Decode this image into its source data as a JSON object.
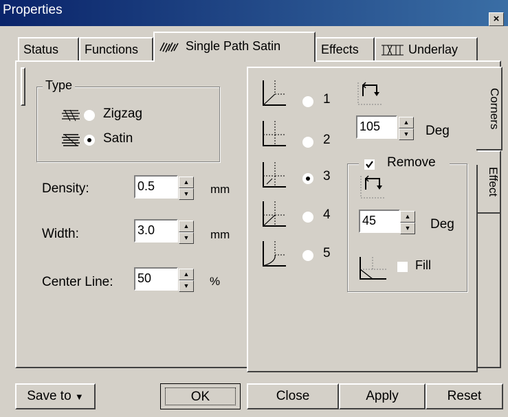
{
  "window": {
    "title": "Properties",
    "close_glyph": "×"
  },
  "tabs": [
    {
      "label": "Status",
      "icon": ""
    },
    {
      "label": "Functions",
      "icon": ""
    },
    {
      "label": "Single Path Satin",
      "icon": "stitch-icon",
      "active": true
    },
    {
      "label": "Effects",
      "icon": ""
    },
    {
      "label": "Underlay",
      "icon": "underlay-icon"
    }
  ],
  "type_group": {
    "legend": "Type",
    "options": [
      {
        "label": "Zigzag",
        "icon": "zigzag-icon",
        "checked": false
      },
      {
        "label": "Satin",
        "icon": "satin-icon",
        "checked": true
      }
    ]
  },
  "settings": [
    {
      "label": "Density:",
      "value": "0.5",
      "unit": "mm"
    },
    {
      "label": "Width:",
      "value": "3.0",
      "unit": "mm"
    },
    {
      "label": "Center Line:",
      "value": "50",
      "unit": "%"
    }
  ],
  "side_tabs": {
    "corners": "Corners",
    "effect": "Effect"
  },
  "corners": {
    "options": [
      {
        "label": "1",
        "checked": false
      },
      {
        "label": "2",
        "checked": false
      },
      {
        "label": "3",
        "checked": true
      },
      {
        "label": "4",
        "checked": false
      },
      {
        "label": "5",
        "checked": false
      }
    ],
    "angle": {
      "value": "105",
      "unit": "Deg"
    },
    "remove": {
      "label": "Remove",
      "checked": true,
      "angle": {
        "value": "45",
        "unit": "Deg"
      },
      "fill_label": "Fill",
      "fill_checked": false
    }
  },
  "buttons": {
    "save": "Save to",
    "save_arrow": "▼",
    "ok": "OK",
    "close": "Close",
    "apply": "Apply",
    "reset": "Reset"
  }
}
